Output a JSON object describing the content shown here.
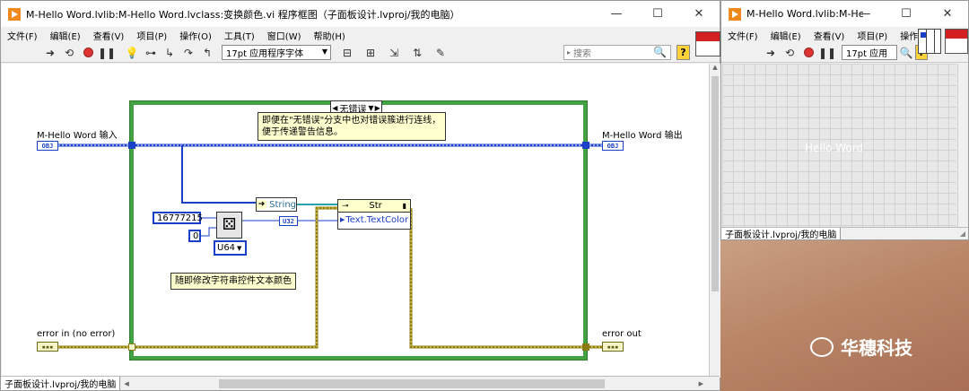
{
  "left_window": {
    "title": "M-Hello Word.lvlib:M-Hello Word.lvclass:变换颜色.vi 程序框图（子面板设计.lvproj/我的电脑）",
    "window_buttons": [
      "—",
      "☐",
      "✕"
    ],
    "menus": [
      "文件(F)",
      "编辑(E)",
      "查看(V)",
      "项目(P)",
      "操作(O)",
      "工具(T)",
      "窗口(W)",
      "帮助(H)"
    ],
    "toolbar": {
      "icons": [
        "run-arrow",
        "run-continuous",
        "abort",
        "pause",
        "highlight-execution",
        "retain-wire-values",
        "step-into",
        "step-over",
        "step-out"
      ],
      "font_value": "17pt 应用程序字体",
      "search_placeholder": "搜索",
      "help_label": "?"
    },
    "status_path": "子面板设计.lvproj/我的电脑",
    "diagram": {
      "case_selector": "无错误",
      "comment_top": "即便在\"无错误\"分支中也对错误簇进行连线，便于传递警告信息。",
      "comment_bottom": "随即修改字符串控件文本颜色",
      "input_label": "M-Hello Word 输入",
      "output_label": "M-Hello Word 输出",
      "error_in_label": "error in (no error)",
      "error_out_label": "error out",
      "obj_tag": "OBJ",
      "err_tag": "▪▪▪",
      "to_more_specific": "String",
      "property_class": "Str",
      "property_name": "Text.TextColor",
      "const_max": "16777215",
      "const_min": "0",
      "random_type": "U64",
      "convert_label": "U32"
    }
  },
  "right_window": {
    "title": "M-Hello Word.lvlib:M-Hello",
    "window_buttons": [
      "—",
      "☐",
      "✕"
    ],
    "menus": [
      "文件(F)",
      "编辑(E)",
      "查看(V)",
      "项目(P)",
      "操作(O)"
    ],
    "font_value": "17pt 应用",
    "help_label": "?",
    "panel_text": "Hello Word",
    "status_path": "子面板设计.lvproj/我的电脑"
  },
  "watermark": {
    "text": "华穗科技"
  },
  "colors": {
    "case_border": "#43a043",
    "wire_class": "#1a3fc8",
    "wire_error": "#8a7a10",
    "wire_u32": "#1a3fc8",
    "comment_bg": "#fffecf"
  }
}
